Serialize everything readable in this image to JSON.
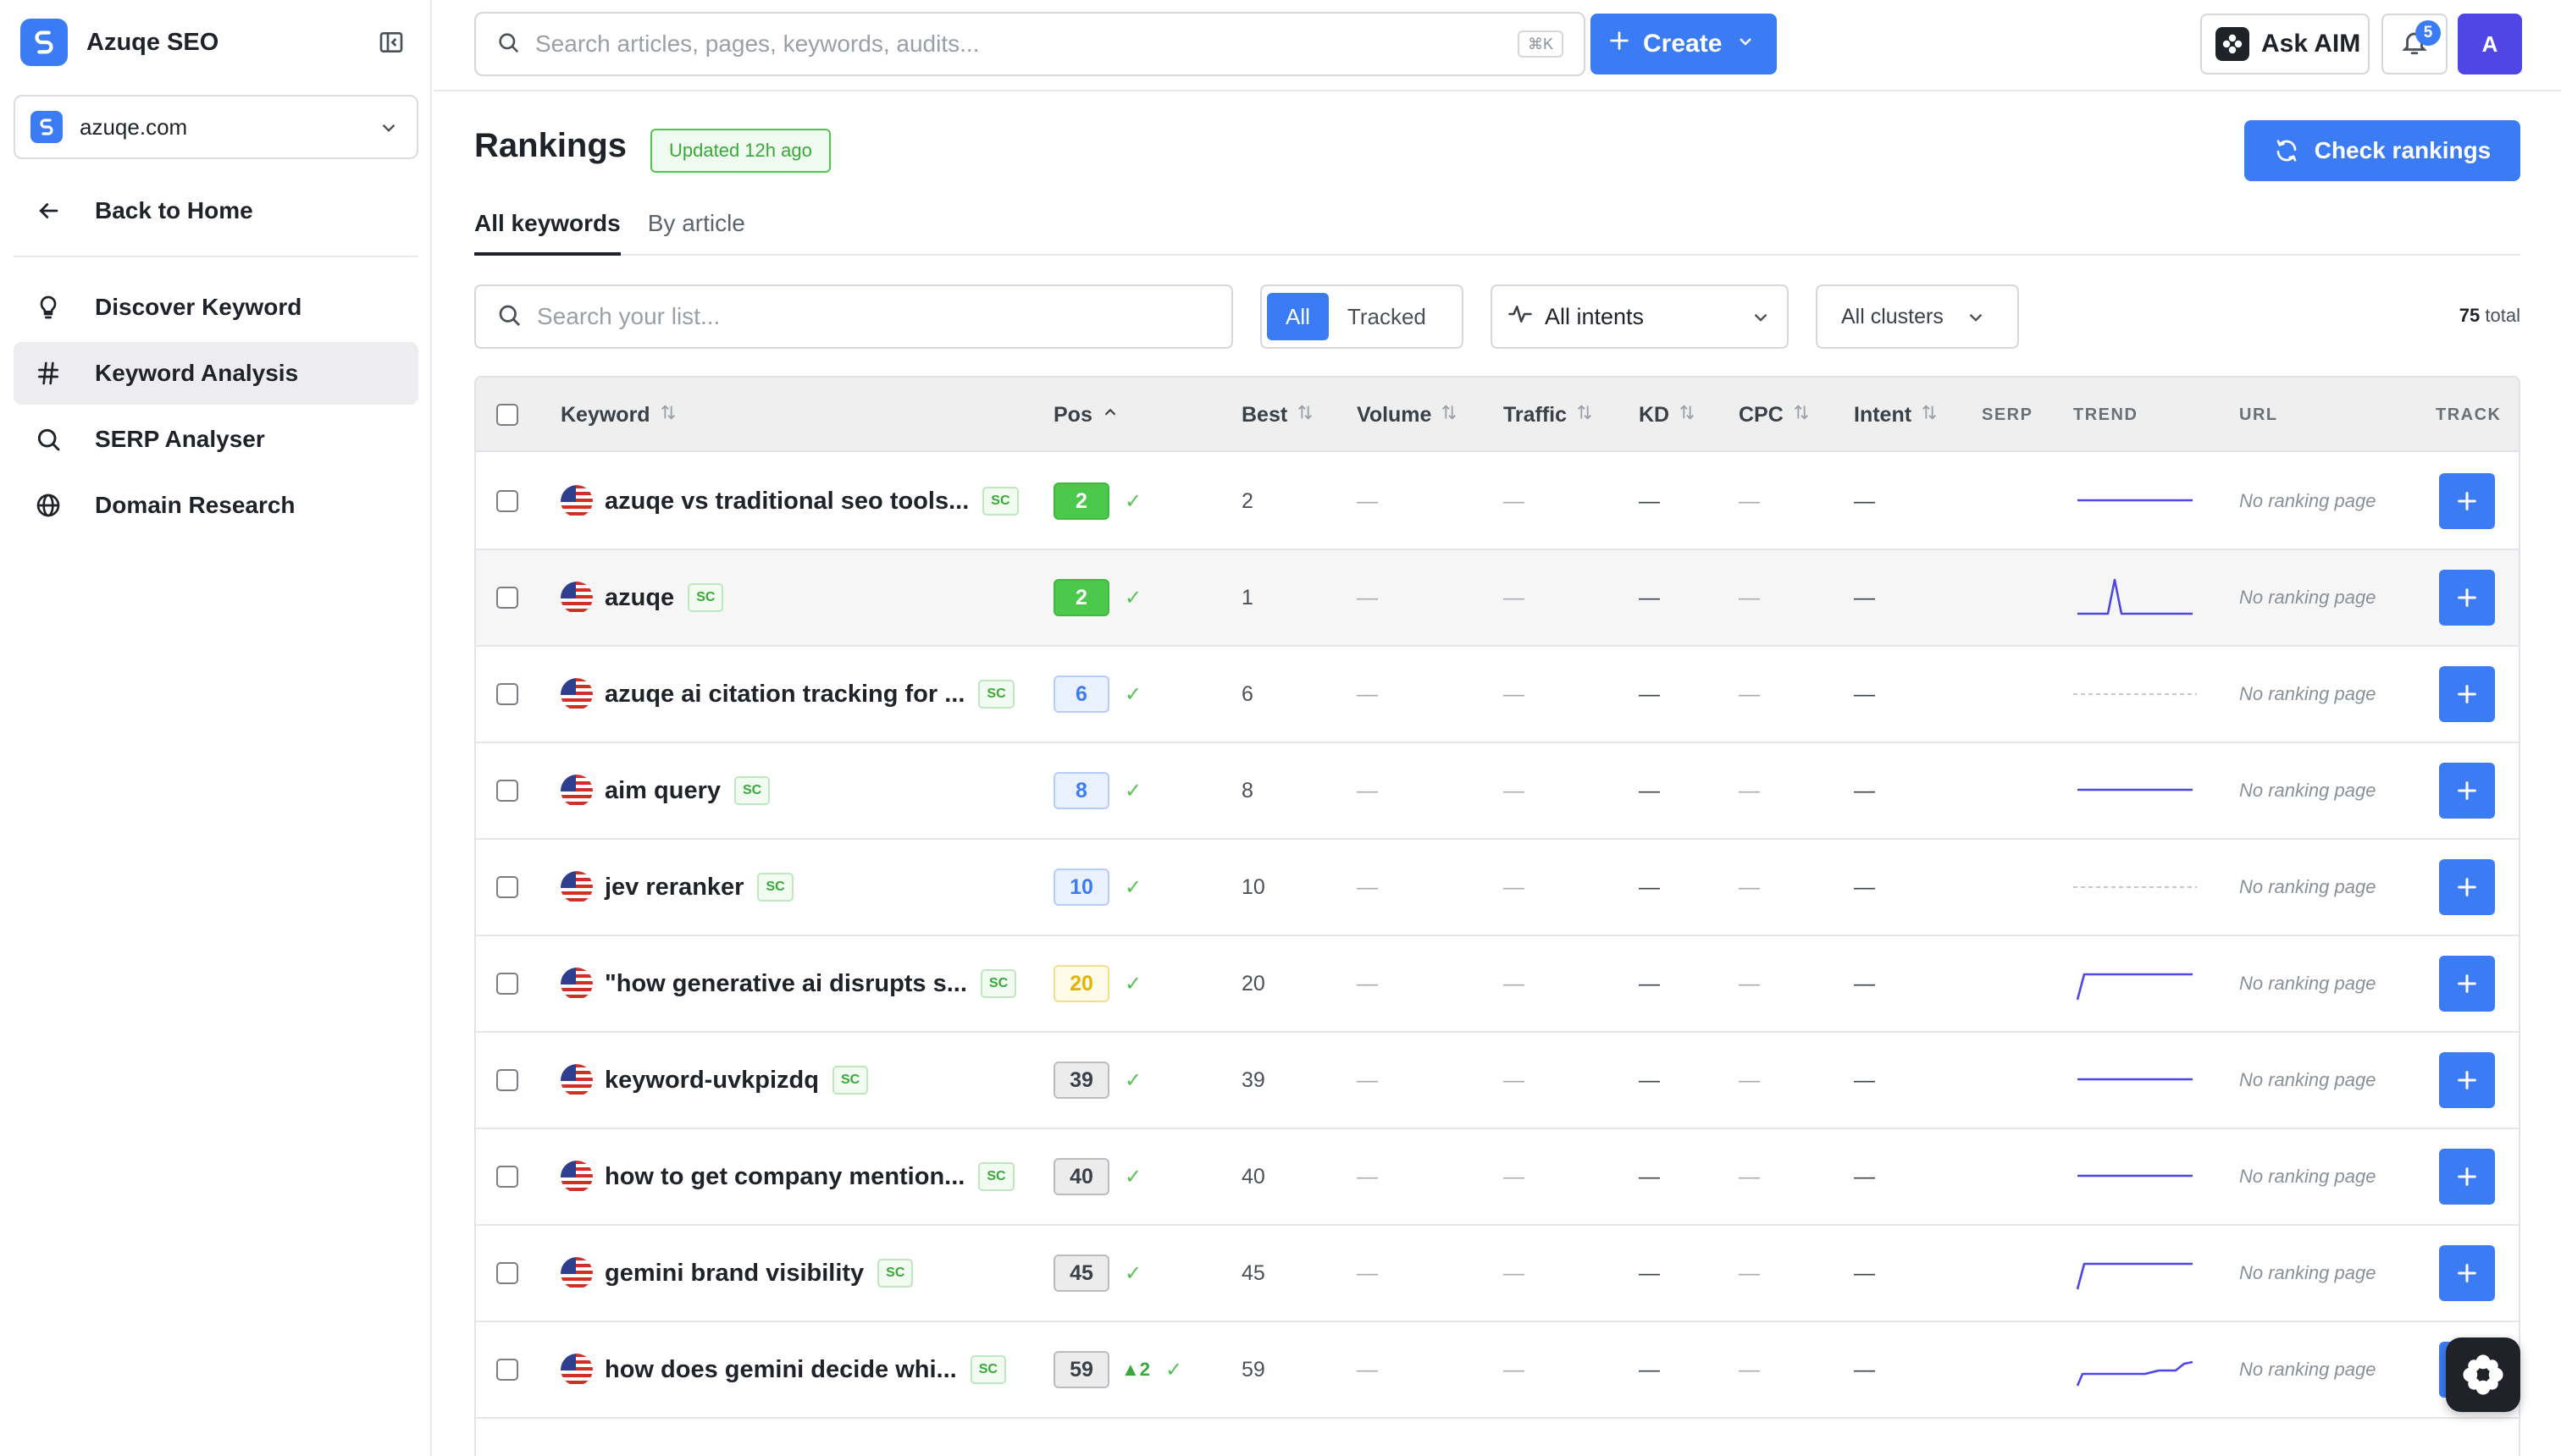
{
  "app": {
    "name": "Azuqe SEO",
    "site": "azuqe.com",
    "back_label": "Back to Home",
    "nav": [
      {
        "label": "Discover Keyword",
        "icon": "lightbulb-icon",
        "active": false
      },
      {
        "label": "Keyword Analysis",
        "icon": "hash-icon",
        "active": true
      },
      {
        "label": "SERP Analyser",
        "icon": "search-icon",
        "active": false
      },
      {
        "label": "Domain Research",
        "icon": "globe-icon",
        "active": false
      }
    ]
  },
  "topbar": {
    "search_placeholder": "Search articles, pages, keywords, audits...",
    "shortcut": "⌘K",
    "create_label": "Create",
    "ask_label": "Ask AIM",
    "notifications_count": "5",
    "avatar_initial": "A"
  },
  "page": {
    "title": "Rankings",
    "updated": "Updated 12h ago",
    "check_label": "Check rankings",
    "tabs": [
      "All keywords",
      "By article"
    ],
    "active_tab": 0
  },
  "filters": {
    "search_placeholder": "Search your list...",
    "segments": [
      "All",
      "Tracked"
    ],
    "active_segment": 0,
    "intent": "All intents",
    "cluster": "All clusters",
    "total_count": "75",
    "total_label": "total"
  },
  "table": {
    "columns": {
      "keyword": "Keyword",
      "pos": "Pos",
      "best": "Best",
      "volume": "Volume",
      "traffic": "Traffic",
      "kd": "KD",
      "cpc": "CPC",
      "intent": "Intent",
      "serp": "SERP",
      "trend": "TREND",
      "url": "URL",
      "track": "TRACK"
    },
    "source_badge": "SC",
    "empty_value": "—",
    "rows": [
      {
        "keyword": "azuqe vs traditional seo tools...",
        "pos": "2",
        "pos_style": "green",
        "delta": "",
        "best": "2",
        "trend": "flat",
        "url": "No ranking page"
      },
      {
        "keyword": "azuqe",
        "pos": "2",
        "pos_style": "green",
        "delta": "",
        "best": "1",
        "trend": "spike",
        "url": "No ranking page"
      },
      {
        "keyword": "azuqe ai citation tracking for ...",
        "pos": "6",
        "pos_style": "blue",
        "delta": "",
        "best": "6",
        "trend": "none",
        "url": "No ranking page"
      },
      {
        "keyword": "aim query",
        "pos": "8",
        "pos_style": "blue",
        "delta": "",
        "best": "8",
        "trend": "flat",
        "url": "No ranking page"
      },
      {
        "keyword": "jev reranker",
        "pos": "10",
        "pos_style": "blue",
        "delta": "",
        "best": "10",
        "trend": "none",
        "url": "No ranking page"
      },
      {
        "keyword": "\"how generative ai disrupts s...",
        "pos": "20",
        "pos_style": "yellow",
        "delta": "",
        "best": "20",
        "trend": "step",
        "url": "No ranking page"
      },
      {
        "keyword": "keyword-uvkpizdq",
        "pos": "39",
        "pos_style": "gray",
        "delta": "",
        "best": "39",
        "trend": "flat",
        "url": "No ranking page"
      },
      {
        "keyword": "how to get company mention...",
        "pos": "40",
        "pos_style": "gray",
        "delta": "",
        "best": "40",
        "trend": "flat",
        "url": "No ranking page"
      },
      {
        "keyword": "gemini brand visibility",
        "pos": "45",
        "pos_style": "gray",
        "delta": "",
        "best": "45",
        "trend": "step",
        "url": "No ranking page"
      },
      {
        "keyword": "how does gemini decide whi...",
        "pos": "59",
        "pos_style": "gray",
        "delta": "▲2",
        "best": "59",
        "trend": "rise",
        "url": "No ranking page"
      }
    ]
  },
  "colors": {
    "accent": "#3b7cf5",
    "green": "#4cc94c",
    "trend_line": "#4f46e5",
    "avatar": "#4f46e5"
  }
}
